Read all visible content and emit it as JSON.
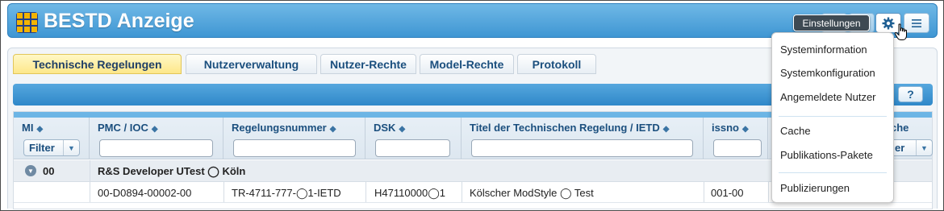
{
  "app": {
    "title": "BESTD Anzeige",
    "logo": "bestd-logo"
  },
  "header_buttons": {
    "settings_icon": "gear-icon",
    "menu_icon": "hamburger-icon"
  },
  "tooltip": {
    "text": "Einstellungen"
  },
  "tabs": [
    {
      "label": "Technische Regelungen",
      "active": true
    },
    {
      "label": "Nutzerverwaltung",
      "active": false
    },
    {
      "label": "Nutzer-Rechte",
      "active": false
    },
    {
      "label": "Model-Rechte",
      "active": false
    },
    {
      "label": "Protokoll",
      "active": false
    }
  ],
  "toolbar": {
    "help_label": "?"
  },
  "grid": {
    "columns": [
      {
        "title": "MI",
        "filter_label": "Filter"
      },
      {
        "title": "PMC / IOC"
      },
      {
        "title": "Regelungsnummer"
      },
      {
        "title": "DSK"
      },
      {
        "title": "Titel der Technischen Regelung / IETD"
      },
      {
        "title": "issno"
      },
      {
        "title": "che",
        "filter_label": "er"
      }
    ],
    "group": {
      "id": "00",
      "title": "R&S Developer UTest ◯ Köln"
    },
    "rows": [
      {
        "pmc": "00-D0894-00002-00",
        "regelungsnummer": "TR-4711-777-◯1-IETD",
        "dsk": "H47110000◯1",
        "titel": "Kölscher ModStyle ◯ Test",
        "issno": "001-00"
      }
    ]
  },
  "menu": {
    "items": [
      "Systeminformation",
      "Systemkonfiguration",
      "Angemeldete Nutzer",
      "Cache",
      "Publikations-Pakete",
      "Publizierungen"
    ]
  },
  "colors": {
    "header": "#3f96d3",
    "active_tab": "#fde78a",
    "accent_text": "#1b4f7e"
  }
}
